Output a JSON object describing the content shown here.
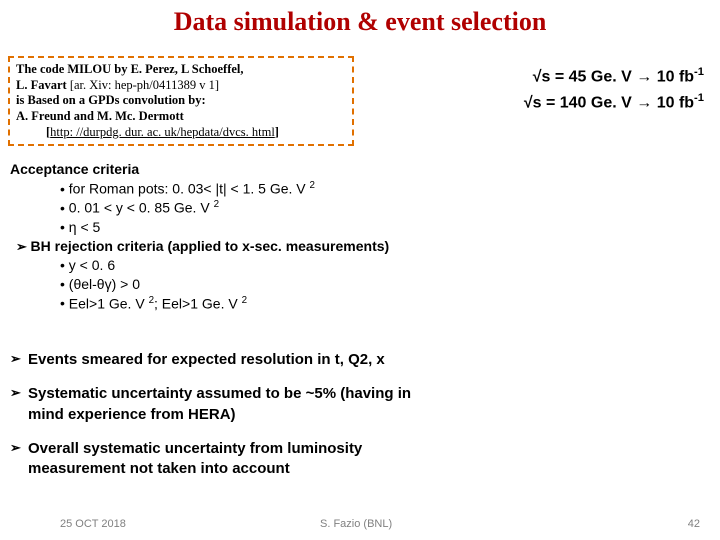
{
  "title": "Data simulation & event selection",
  "code_box": {
    "l1": "The code MILOU by E. Perez, L Schoeffel,",
    "l2a": "L. Favart ",
    "l2b": "[ar. Xiv: hep-ph/0411389 v 1]",
    "l3": "is Based on a GPDs convolution by:",
    "l4": "A. Freund and M. Mc. Dermott",
    "l5a": "[",
    "l5b": "http: //durpdg. dur. ac. uk/hepdata/dvcs. html",
    "l5c": "]"
  },
  "energy": {
    "e1a": "√s = 45 Ge. V  ",
    "e1b": "→",
    "e1c": "  10 fb",
    "e2a": "√s = 140 Ge. V ",
    "e2b": "→",
    "e2c": "  10 fb"
  },
  "criteria": {
    "h1": "Acceptance criteria",
    "a1": "for Roman pots: 0. 03< |t| < 1. 5 Ge. V",
    "a2": "0. 01 < y < 0. 85 Ge. V",
    "a3": "η < 5",
    "h2": "BH rejection criteria (applied to x-sec. measurements)",
    "b1": "y < 0. 6",
    "b2": "(θel-θγ) > 0",
    "b3": "Eel>1 Ge. V"
  },
  "bottom": {
    "i1": "Events smeared for expected resolution in t, Q2, x",
    "i2": "Systematic uncertainty assumed to be ~5% (having in mind experience from HERA)",
    "i3": "Overall systematic uncertainty from luminosity measurement not taken into account"
  },
  "footer": {
    "date": "25 OCT 2018",
    "author": "S. Fazio (BNL)",
    "page": "42"
  }
}
